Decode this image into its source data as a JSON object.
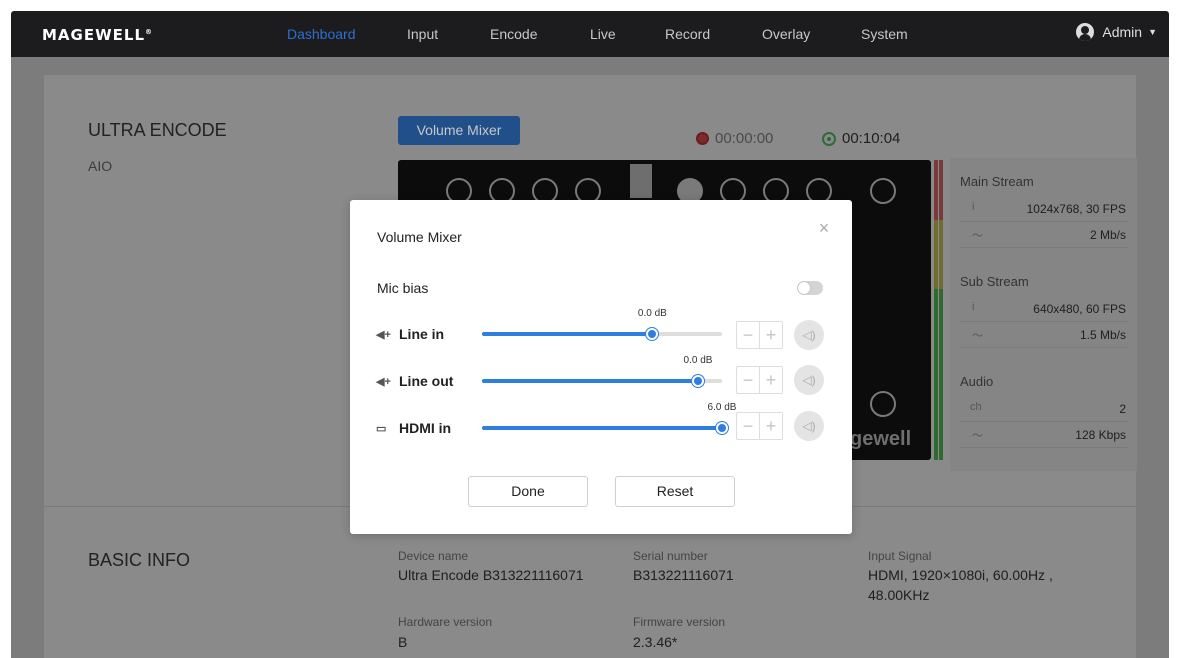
{
  "nav": {
    "logo": "MAGEWELL",
    "logo_mark": "®",
    "items": [
      "Dashboard",
      "Input",
      "Encode",
      "Live",
      "Record",
      "Overlay",
      "System"
    ],
    "active": "Dashboard",
    "user": "Admin"
  },
  "device": {
    "title": "ULTRA ENCODE",
    "subtitle": "AIO",
    "volume_mixer_button": "Volume Mixer",
    "record_time": "00:00:00",
    "live_time": "00:10:04",
    "preview_brand": "gewell"
  },
  "stats": {
    "main_stream": {
      "title": "Main Stream",
      "resolution": "1024x768, 30 FPS",
      "bitrate": "2 Mb/s"
    },
    "sub_stream": {
      "title": "Sub Stream",
      "resolution": "640x480, 60 FPS",
      "bitrate": "1.5 Mb/s"
    },
    "audio": {
      "title": "Audio",
      "ch_label": "ch",
      "channels": "2",
      "bitrate": "128 Kbps"
    }
  },
  "basic_info": {
    "title": "BASIC INFO",
    "device_name_label": "Device name",
    "device_name": "Ultra Encode B313221116071",
    "serial_label": "Serial number",
    "serial": "B313221116071",
    "input_signal_label": "Input Signal",
    "input_signal_line1": "HDMI, 1920×1080i, 60.00Hz ,",
    "input_signal_line2": "48.00KHz",
    "hardware_label": "Hardware version",
    "hardware": "B",
    "firmware_label": "Firmware version",
    "firmware": "2.3.46*"
  },
  "modal": {
    "title": "Volume Mixer",
    "mic_bias_label": "Mic bias",
    "mic_bias_on": false,
    "channels": [
      {
        "name": "Line in",
        "db": "0.0 dB",
        "level": 0.71
      },
      {
        "name": "Line out",
        "db": "0.0 dB",
        "level": 0.9
      },
      {
        "name": "HDMI in",
        "db": "6.0 dB",
        "level": 1.0
      }
    ],
    "done_label": "Done",
    "reset_label": "Reset"
  }
}
